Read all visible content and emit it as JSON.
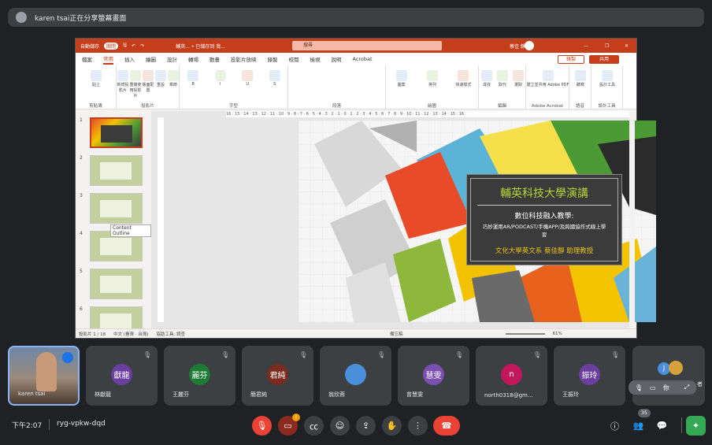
{
  "meet": {
    "share_banner": "karen tsai正在分享螢幕畫面",
    "time": "下午2:07",
    "meeting_code": "ryg-vpkw-dqd",
    "participant_count": "35",
    "accent_red": "#ea4335",
    "participants": [
      {
        "name": "karen tsai",
        "initials": "",
        "color": "#5f6368",
        "video": true
      },
      {
        "name": "林獻龍",
        "initials": "獻龍",
        "color": "#6a3fa0"
      },
      {
        "name": "王麗芬",
        "initials": "麗芬",
        "color": "#1e7b34"
      },
      {
        "name": "簡君純",
        "initials": "君純",
        "color": "#7b2c1e"
      },
      {
        "name": "翁欣蓉",
        "initials": "",
        "color": "#4a8fd9"
      },
      {
        "name": "曾慧雯",
        "initials": "慧雯",
        "color": "#7a4fb0"
      },
      {
        "name": "north0318@gm...",
        "initials": "n",
        "color": "#c2185b"
      },
      {
        "name": "王振玲",
        "initials": "振玲",
        "color": "#6a3fa0"
      }
    ],
    "extra_tile": {
      "initial_j": "J",
      "you_label": "你",
      "suffix": "者"
    }
  },
  "ppt": {
    "autosave": "自動儲存",
    "autosave_state": "關閉",
    "filename": "輔英... • 已儲存到 我...",
    "search_placeholder": "搜尋",
    "user": "蔡佳 靜修",
    "comments_label": "",
    "record_label": "錄製",
    "share_label": "共用",
    "tabs": [
      "檔案",
      "常用",
      "插入",
      "繪圖",
      "設計",
      "轉場",
      "動畫",
      "投影片放映",
      "錄製",
      "校閱",
      "檢視",
      "說明",
      "Acrobat"
    ],
    "active_tab": "常用",
    "groups": [
      {
        "label": "剪貼簿",
        "buttons": [
          "貼上"
        ]
      },
      {
        "label": "投影片",
        "buttons": [
          "新增投影片",
          "重複使用投影片",
          "版面配置",
          "重設",
          "章節"
        ]
      },
      {
        "label": "字型",
        "buttons": [
          "B",
          "I",
          "U",
          "S"
        ]
      },
      {
        "label": "段落",
        "buttons": []
      },
      {
        "label": "繪圖",
        "buttons": [
          "圖案",
          "排列",
          "快速樣式"
        ]
      },
      {
        "label": "編輯",
        "buttons": [
          "尋找",
          "取代",
          "選取"
        ]
      },
      {
        "label": "Adobe Acrobat",
        "buttons": [
          "建立並共用 Adobe PDF"
        ]
      },
      {
        "label": "語音",
        "buttons": [
          "聽寫"
        ]
      },
      {
        "label": "設計工具",
        "buttons": [
          "設計工具"
        ]
      }
    ],
    "tooltip": "Content Outline",
    "ruler": "16 · 15 · 14 · 13 · 12 · 11 · 10 · 9 · 8 · 7 · 6 · 5 · 4 · 3 · 2 · 1 · 0 · 1 · 2 · 3 · 4 · 5 · 6 · 7 · 8 · 9 · 10 · 11 · 12 · 13 · 14 · 15 · 16",
    "slide_numbers": [
      "1",
      "2",
      "3",
      "4",
      "5",
      "6"
    ],
    "slide_title": "輔英科技大學演講",
    "slide_subtitle": "數位科技融入教學:",
    "slide_subtitle2": "巧妙運用AR/PODCAST/手機APP/及跨國協作式線上學習",
    "slide_author": "文化大學英文系  蔡佳靜 助理教授",
    "status_slide": "投影片 1 / 18",
    "status_lang": "中文 (臺灣 · 台灣)",
    "status_access": "協助工具: 調查",
    "status_notes": "備忘稿",
    "zoom": "61%"
  }
}
